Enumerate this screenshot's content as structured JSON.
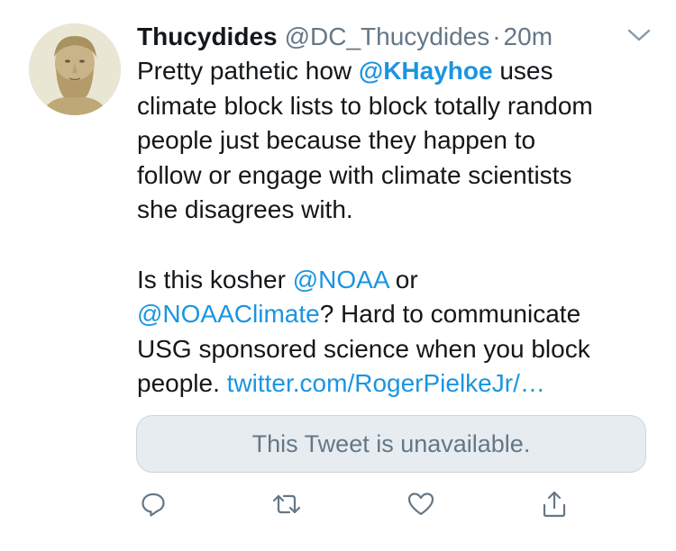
{
  "tweet": {
    "author_name": "Thucydides",
    "author_handle": "@DC_Thucydides",
    "separator": "·",
    "time": "20m",
    "text": {
      "l1_a": "Pretty pathetic how ",
      "l1_mention": "@KHayhoe",
      "l1_b": " uses",
      "l2": "climate block lists to block totally random",
      "l3": "people just because they happen to",
      "l4": "follow or engage with climate scientists",
      "l5": "she disagrees with.",
      "l7_a": "Is this kosher ",
      "l7_mention": "@NOAA",
      "l7_b": " or",
      "l8_mention": "@NOAAClimate",
      "l8_b": "?  Hard to communicate",
      "l9": "USG sponsored science when you block",
      "l10_a": "people. ",
      "l10_link": "twitter.com/RogerPielkeJr/…"
    },
    "quoted_unavailable": "This Tweet is unavailable."
  },
  "icons": {
    "caret": "chevron-down-icon",
    "reply": "reply-icon",
    "retweet": "retweet-icon",
    "like": "heart-icon",
    "share": "share-icon"
  },
  "colors": {
    "link": "#1b95e0",
    "secondary_text": "#657786",
    "icon": "#657786",
    "quote_background": "#e6ecf0"
  }
}
